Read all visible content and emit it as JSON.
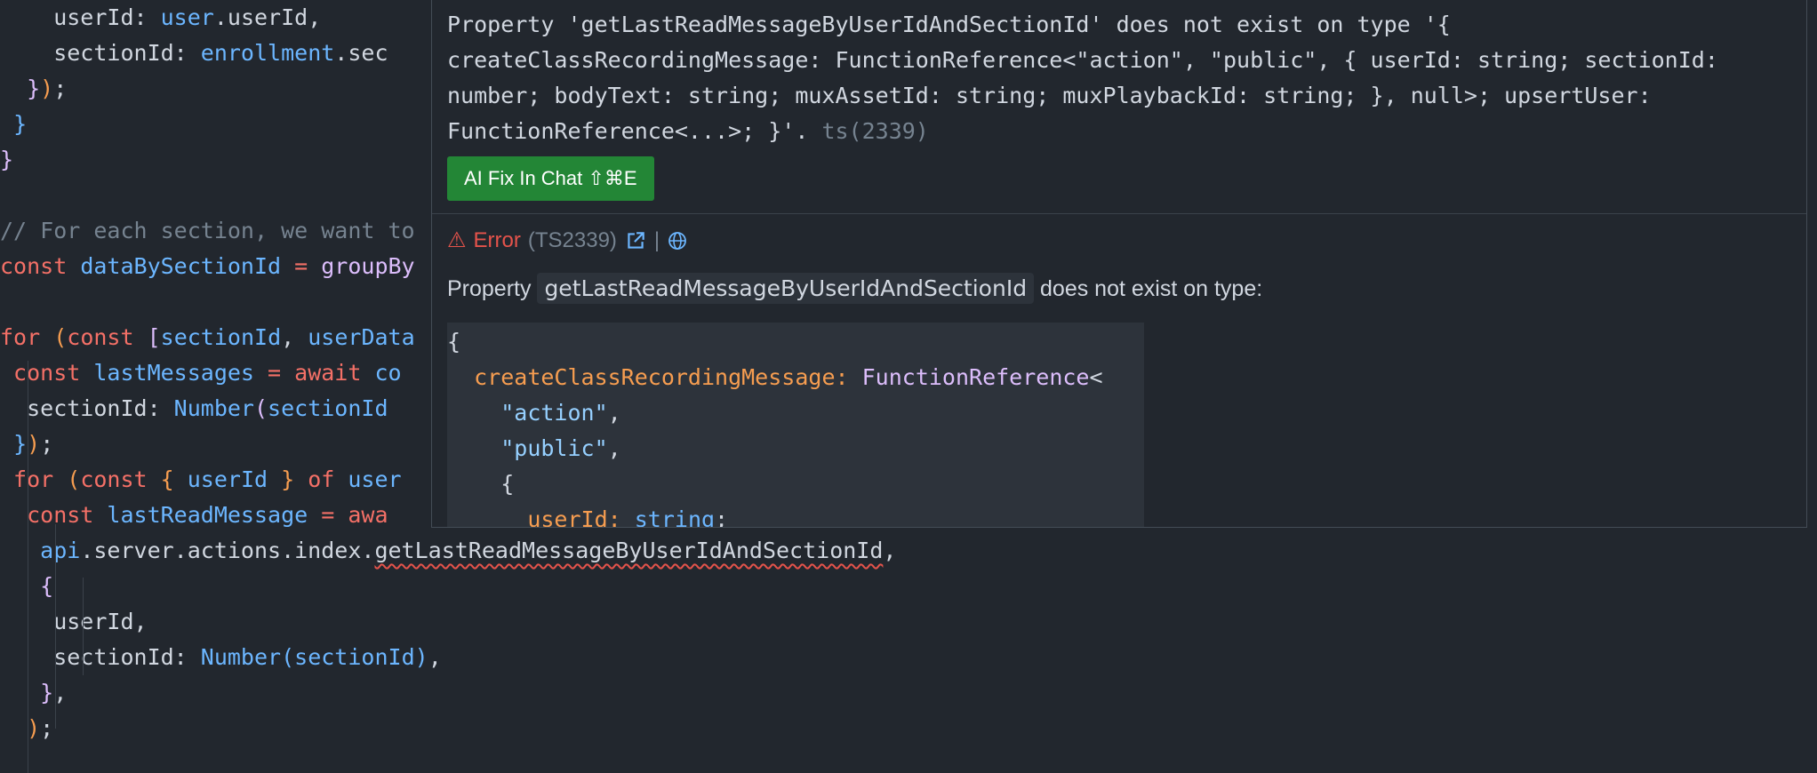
{
  "editor": {
    "lines": [
      {
        "top": 0,
        "segs": [
          {
            "t": "    userId: ",
            "c": "t-plain"
          },
          {
            "t": "user",
            "c": "t-var"
          },
          {
            "t": ".userId,",
            "c": "t-plain"
          }
        ]
      },
      {
        "top": 0,
        "segs": [
          {
            "t": "    sectionId: ",
            "c": "t-plain"
          },
          {
            "t": "enrollment",
            "c": "t-var"
          },
          {
            "t": ".sec",
            "c": "t-plain"
          }
        ]
      },
      {
        "top": 0,
        "segs": [
          {
            "t": "  ",
            "c": "t-plain"
          },
          {
            "t": "}",
            "c": "t-b1"
          },
          {
            "t": ")",
            "c": "t-b3"
          },
          {
            "t": ";",
            "c": "t-plain"
          }
        ]
      },
      {
        "top": 0,
        "segs": [
          {
            "t": " ",
            "c": "t-plain"
          },
          {
            "t": "}",
            "c": "t-b2"
          }
        ]
      },
      {
        "top": 0,
        "segs": [
          {
            "t": "}",
            "c": "t-b1"
          }
        ]
      },
      {
        "top": 0,
        "segs": []
      },
      {
        "top": 0,
        "segs": [
          {
            "t": "// For each section, we want to",
            "c": "t-com"
          }
        ]
      },
      {
        "top": 0,
        "segs": [
          {
            "t": "const ",
            "c": "t-kw"
          },
          {
            "t": "dataBySectionId",
            "c": "t-var"
          },
          {
            "t": " = ",
            "c": "t-kw"
          },
          {
            "t": "groupBy",
            "c": "t-fn"
          }
        ]
      },
      {
        "top": 0,
        "segs": []
      },
      {
        "top": 0,
        "segs": [
          {
            "t": "for ",
            "c": "t-kw"
          },
          {
            "t": "(",
            "c": "t-b3"
          },
          {
            "t": "const ",
            "c": "t-kw"
          },
          {
            "t": "[",
            "c": "t-b1"
          },
          {
            "t": "sectionId",
            "c": "t-var"
          },
          {
            "t": ", ",
            "c": "t-plain"
          },
          {
            "t": "userData",
            "c": "t-var"
          }
        ]
      },
      {
        "top": 0,
        "segs": [
          {
            "t": " const ",
            "c": "t-kw"
          },
          {
            "t": "lastMessages",
            "c": "t-var"
          },
          {
            "t": " = ",
            "c": "t-kw"
          },
          {
            "t": "await ",
            "c": "t-kw"
          },
          {
            "t": "co",
            "c": "t-var"
          }
        ]
      },
      {
        "top": 0,
        "segs": [
          {
            "t": "  sectionId: ",
            "c": "t-plain"
          },
          {
            "t": "Number",
            "c": "t-var"
          },
          {
            "t": "(",
            "c": "t-b1"
          },
          {
            "t": "sectionId",
            "c": "t-var"
          }
        ]
      },
      {
        "top": 0,
        "segs": [
          {
            "t": " ",
            "c": "t-plain"
          },
          {
            "t": "}",
            "c": "t-b2"
          },
          {
            "t": ")",
            "c": "t-b3"
          },
          {
            "t": ";",
            "c": "t-plain"
          }
        ]
      },
      {
        "top": 0,
        "segs": [
          {
            "t": " for ",
            "c": "t-kw"
          },
          {
            "t": "(",
            "c": "t-b3"
          },
          {
            "t": "const ",
            "c": "t-kw"
          },
          {
            "t": "{ ",
            "c": "t-b3"
          },
          {
            "t": "userId",
            "c": "t-var"
          },
          {
            "t": " } ",
            "c": "t-b3"
          },
          {
            "t": "of ",
            "c": "t-kw"
          },
          {
            "t": "user",
            "c": "t-var"
          }
        ]
      },
      {
        "top": 0,
        "segs": [
          {
            "t": "  const ",
            "c": "t-kw"
          },
          {
            "t": "lastReadMessage",
            "c": "t-var"
          },
          {
            "t": " = ",
            "c": "t-kw"
          },
          {
            "t": "awa",
            "c": "t-kw"
          }
        ]
      },
      {
        "top": 0,
        "segs": [
          {
            "t": "   ",
            "c": "t-plain"
          },
          {
            "t": "api",
            "c": "t-var"
          },
          {
            "t": ".server.actions.index.",
            "c": "t-plain"
          },
          {
            "t": "getLastReadMessageByUserIdAndSectionId",
            "c": "t-plain t-err"
          },
          {
            "t": ",",
            "c": "t-plain"
          }
        ]
      },
      {
        "top": 0,
        "segs": [
          {
            "t": "   ",
            "c": "t-plain"
          },
          {
            "t": "{",
            "c": "t-b1"
          }
        ]
      },
      {
        "top": 0,
        "segs": [
          {
            "t": "    userId,",
            "c": "t-plain"
          }
        ]
      },
      {
        "top": 0,
        "segs": [
          {
            "t": "    sectionId: ",
            "c": "t-plain"
          },
          {
            "t": "Number",
            "c": "t-var"
          },
          {
            "t": "(",
            "c": "t-b2"
          },
          {
            "t": "sectionId",
            "c": "t-var"
          },
          {
            "t": ")",
            "c": "t-b2"
          },
          {
            "t": ",",
            "c": "t-plain"
          }
        ]
      },
      {
        "top": 0,
        "segs": [
          {
            "t": "   ",
            "c": "t-plain"
          },
          {
            "t": "}",
            "c": "t-b1"
          },
          {
            "t": ",",
            "c": "t-plain"
          }
        ]
      },
      {
        "top": 0,
        "segs": [
          {
            "t": "  ",
            "c": "t-plain"
          },
          {
            "t": ")",
            "c": "t-b3"
          },
          {
            "t": ";",
            "c": "t-plain"
          }
        ]
      }
    ]
  },
  "hover": {
    "message": "Property 'getLastReadMessageByUserIdAndSectionId' does not exist on type '{ createClassRecordingMessage: FunctionReference<\"action\", \"public\", { userId: string; sectionId: number; bodyText: string; muxAssetId: string; muxPlaybackId: string; }, null>; upsertUser: FunctionReference<...>; }'.",
    "code_ref": " ts(2339)",
    "fix_label": "AI Fix In Chat ⇧⌘E",
    "error_label": "Error",
    "error_code": "(TS2339)",
    "divider": "|",
    "desc_before": "Property ",
    "desc_ident": "getLastReadMessageByUserIdAndSectionId",
    "desc_after": " does not exist on type:",
    "type_lines": [
      {
        "segs": [
          {
            "t": "{",
            "c": ""
          }
        ]
      },
      {
        "segs": [
          {
            "t": "  ",
            "c": ""
          },
          {
            "t": "createClassRecordingMessage: ",
            "c": "k"
          },
          {
            "t": "FunctionReference",
            "c": "ty"
          },
          {
            "t": "<",
            "c": ""
          }
        ]
      },
      {
        "segs": [
          {
            "t": "    ",
            "c": ""
          },
          {
            "t": "\"action\"",
            "c": "s"
          },
          {
            "t": ",",
            "c": ""
          }
        ]
      },
      {
        "segs": [
          {
            "t": "    ",
            "c": ""
          },
          {
            "t": "\"public\"",
            "c": "s"
          },
          {
            "t": ",",
            "c": ""
          }
        ]
      },
      {
        "segs": [
          {
            "t": "    {",
            "c": ""
          }
        ]
      },
      {
        "segs": [
          {
            "t": "      ",
            "c": ""
          },
          {
            "t": "userId: ",
            "c": "k"
          },
          {
            "t": "string",
            "c": "bt"
          },
          {
            "t": ";",
            "c": ""
          }
        ]
      }
    ]
  }
}
